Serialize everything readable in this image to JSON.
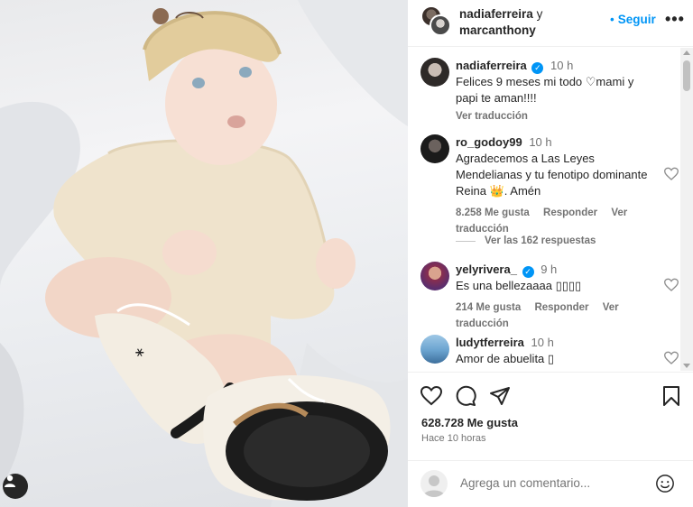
{
  "post": {
    "owners": {
      "user1": "nadiaferreira",
      "joiner": "y",
      "user2": "marcanthony"
    },
    "follow_label": "Seguir",
    "more_label": "•••"
  },
  "comments": [
    {
      "username": "nadiaferreira",
      "verified": true,
      "time": "10 h",
      "text": "Felices 9 meses mi todo ♡mami y papi te aman!!!!",
      "translate": "Ver traducción"
    },
    {
      "username": "ro_godoy99",
      "verified": false,
      "time": "10 h",
      "text": "Agradecemos a Las Leyes Mendelianas y tu fenotipo dominante Reina 👑. Amén",
      "likes": "8.258 Me gusta",
      "reply": "Responder",
      "translate": "Ver traducción",
      "view_replies": "Ver las 162 respuestas"
    },
    {
      "username": "yelyrivera_",
      "verified": true,
      "time": "9 h",
      "text": "Es una bellezaaaa ▯▯▯▯",
      "likes": "214 Me gusta",
      "reply": "Responder",
      "translate": "Ver traducción"
    },
    {
      "username": "ludytferreira",
      "verified": false,
      "time": "10 h",
      "text": "Amor de abuelita ▯"
    }
  ],
  "footer": {
    "likes": "628.728 Me gusta",
    "ago": "Hace 10 horas",
    "comment_placeholder": "Agrega un comentario..."
  },
  "icons": [
    "heart-icon",
    "comment-icon",
    "share-icon",
    "bookmark-icon",
    "emoji-icon",
    "user-tag-icon"
  ],
  "colors": {
    "accent": "#0095f6",
    "muted": "#737373",
    "text": "#262626",
    "verified": "#0095f6"
  }
}
